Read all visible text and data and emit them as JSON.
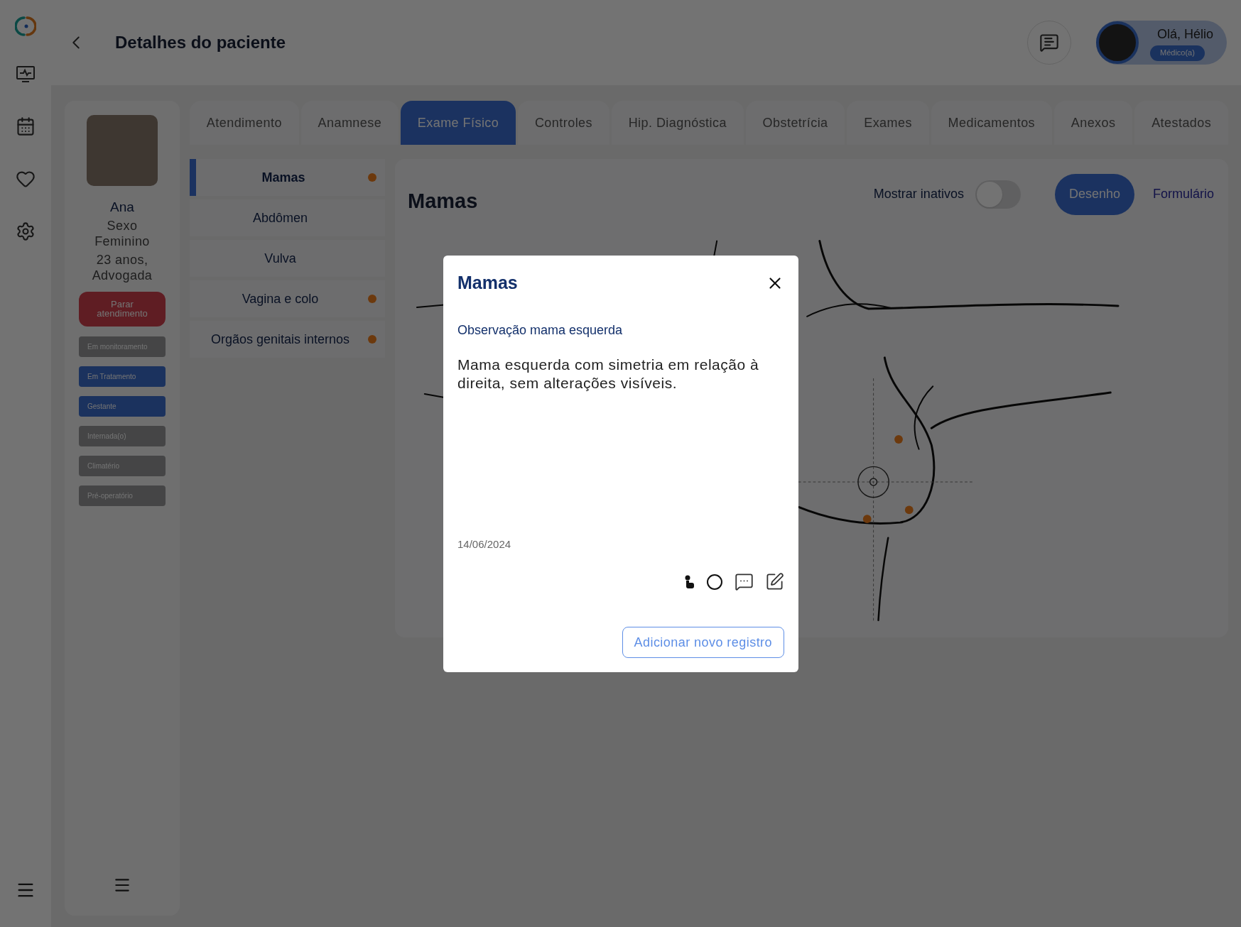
{
  "header": {
    "title": "Detalhes do paciente",
    "user": {
      "greeting": "Olá, Hélio",
      "role": "Médico(a)"
    }
  },
  "patient": {
    "name": "Ana",
    "sex": "Sexo Feminino",
    "age_job": "23 anos, Advogada",
    "stop_button": "Parar atendimento",
    "tags": [
      {
        "label": "Em monitoramento",
        "active": false
      },
      {
        "label": "Em Tratamento",
        "active": true
      },
      {
        "label": "Gestante",
        "active": true
      },
      {
        "label": "Internada(o)",
        "active": false
      },
      {
        "label": "Climatério",
        "active": false
      },
      {
        "label": "Pré-operatório",
        "active": false
      }
    ]
  },
  "tabs": [
    {
      "label": "Atendimento",
      "selected": false
    },
    {
      "label": "Anamnese",
      "selected": false
    },
    {
      "label": "Exame Físico",
      "selected": true
    },
    {
      "label": "Controles",
      "selected": false
    },
    {
      "label": "Hip. Diagnóstica",
      "selected": false
    },
    {
      "label": "Obstetrícia",
      "selected": false
    },
    {
      "label": "Exames",
      "selected": false
    },
    {
      "label": "Medicamentos",
      "selected": false
    },
    {
      "label": "Anexos",
      "selected": false
    },
    {
      "label": "Atestados",
      "selected": false
    }
  ],
  "sections": [
    {
      "label": "Mamas",
      "selected": true,
      "flagged": true
    },
    {
      "label": "Abdômen",
      "selected": false,
      "flagged": false
    },
    {
      "label": "Vulva",
      "selected": false,
      "flagged": false
    },
    {
      "label": "Vagina e colo",
      "selected": false,
      "flagged": true
    },
    {
      "label": "Orgãos genitais internos",
      "selected": false,
      "flagged": true
    }
  ],
  "panel": {
    "title": "Mamas",
    "toggle": {
      "label": "Mostrar inativos",
      "on": false
    },
    "views": [
      {
        "label": "Desenho",
        "selected": true
      },
      {
        "label": "Formulário",
        "selected": false
      }
    ]
  },
  "modal": {
    "title": "Mamas",
    "subtitle": "Observação mama esquerda",
    "body": "Mama esquerda com simetria em relação à direita, sem alterações visíveis.",
    "date": "14/06/2024",
    "add_button": "Adicionar novo registro"
  }
}
